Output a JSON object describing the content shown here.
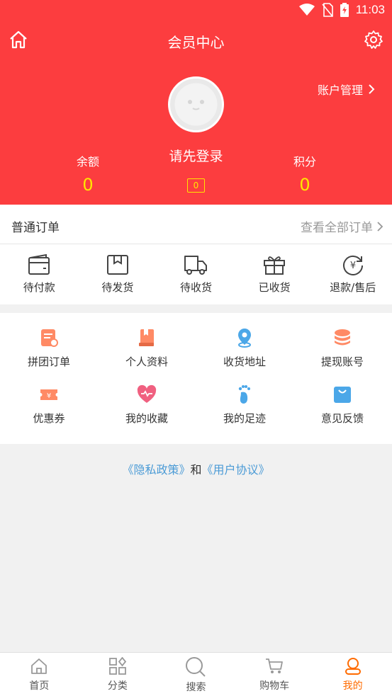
{
  "status": {
    "time": "11:03"
  },
  "header": {
    "title": "会员中心",
    "account_mgmt": "账户管理",
    "login_prompt": "请先登录",
    "balance_label": "余额",
    "balance_value": "0",
    "points_label": "积分",
    "points_value": "0",
    "badge_value": "0"
  },
  "orders": {
    "title": "普通订单",
    "view_all": "查看全部订单",
    "items": [
      {
        "label": "待付款",
        "icon": "wallet-icon"
      },
      {
        "label": "待发货",
        "icon": "box-icon"
      },
      {
        "label": "待收货",
        "icon": "truck-icon"
      },
      {
        "label": "已收货",
        "icon": "gift-icon"
      },
      {
        "label": "退款/售后",
        "icon": "refund-icon"
      }
    ]
  },
  "services": [
    {
      "label": "拼团订单",
      "icon": "group-order-icon"
    },
    {
      "label": "个人资料",
      "icon": "profile-book-icon"
    },
    {
      "label": "收货地址",
      "icon": "location-pin-icon"
    },
    {
      "label": "提现账号",
      "icon": "coins-icon"
    },
    {
      "label": "优惠券",
      "icon": "coupon-icon"
    },
    {
      "label": "我的收藏",
      "icon": "heart-icon"
    },
    {
      "label": "我的足迹",
      "icon": "footprint-icon"
    },
    {
      "label": "意见反馈",
      "icon": "feedback-bag-icon"
    }
  ],
  "policy": {
    "privacy": "《隐私政策》",
    "and": "和",
    "agreement": "《用户协议》"
  },
  "tabbar": [
    {
      "label": "首页",
      "icon": "home-icon"
    },
    {
      "label": "分类",
      "icon": "category-icon"
    },
    {
      "label": "搜索",
      "icon": "search-icon"
    },
    {
      "label": "购物车",
      "icon": "cart-icon"
    },
    {
      "label": "我的",
      "icon": "user-icon",
      "active": true
    }
  ],
  "colors": {
    "brand": "#fc3d3f",
    "accent": "#ff6b00",
    "value": "#ffe600",
    "link": "#4b9bd6"
  }
}
